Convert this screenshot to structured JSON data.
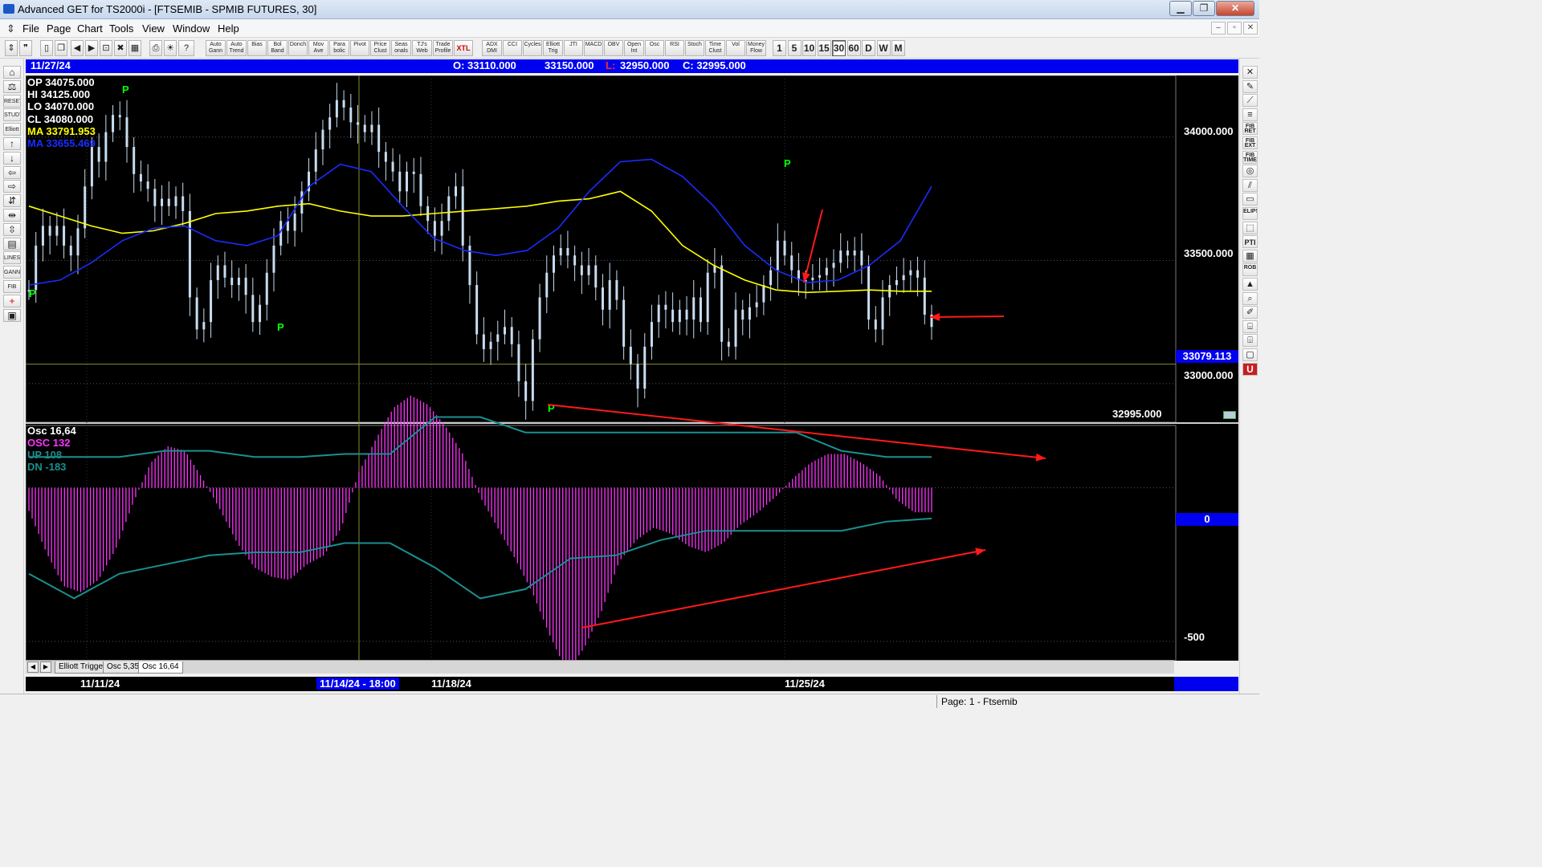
{
  "window": {
    "title": "Advanced GET for TS2000i - [FTSEMIB - SPMIB FUTURES, 30]",
    "min": "▁",
    "max": "❐",
    "close": "✕"
  },
  "menu": [
    "File",
    "Page",
    "Chart",
    "Tools",
    "View",
    "Window",
    "Help"
  ],
  "mdi_controls": [
    "–",
    "▫",
    "✕"
  ],
  "toolbar": {
    "studies": [
      "Auto Gann",
      "Auto Trend",
      "Bias",
      "Bol Band",
      "Donch",
      "Mov Ave",
      "Para bolic",
      "Pivot",
      "Price Clust",
      "Seas onals",
      "TJ's Web",
      "Trade Profile",
      "XTL",
      "ADX DMI",
      "CCI",
      "Cycles",
      "Elliott Trig",
      "JTI",
      "MACD",
      "OBV",
      "Open Int",
      "Osc",
      "RSI",
      "Stoch",
      "Time Clust",
      "Vol",
      "Money Flow"
    ],
    "timeframes": [
      "1",
      "5",
      "10",
      "15",
      "30",
      "60",
      "D",
      "W",
      "M"
    ],
    "selected_timeframe": "30"
  },
  "left_tools": [
    "RESET",
    "STUDY",
    "Elliott",
    "LINES",
    "GANN",
    "FIB"
  ],
  "right_tools": [
    "FIB RET",
    "FIB EXT",
    "FIB TIME",
    "ELIPS",
    "PTI",
    "ROB"
  ],
  "infobar": {
    "date": "11/27/24",
    "open": "O: 33110.000",
    "high": "33150.000",
    "low_prefix": "L:",
    "low": "32950.000",
    "close": "C: 32995.000"
  },
  "price_panel": {
    "stats": {
      "op": "OP  34075.000",
      "hi": "HI   34125.000",
      "lo": "LO  34070.000",
      "cl": "CL  34080.000",
      "ma1": "MA  33791.953",
      "ma2": "MA  33655.469"
    },
    "axis_labels": [
      "34000.000",
      "33500.000",
      "33000.000"
    ],
    "crosshair_value": "33079.113",
    "last_close": "32995.000",
    "pivot_marker": "P"
  },
  "osc_panel": {
    "title": "Osc 16,64",
    "osc": "OSC 132",
    "up": "UP    108",
    "dn": "DN   -183",
    "zero_label": "0",
    "low_label": "-500"
  },
  "tabs": [
    "Elliott Trigger",
    "Osc 5,35",
    "Osc 16,64"
  ],
  "tab_arrows": [
    "◀",
    "▶"
  ],
  "dates": [
    "11/11/24",
    "11/14/24 - 18:00",
    "11/18/24",
    "11/25/24"
  ],
  "status": "Page: 1 - Ftsemib",
  "colors": {
    "candle": "#c8dcf0",
    "ma_yellow": "#ffff00",
    "ma_blue": "#1a2cff",
    "osc_magenta": "#ff33ff",
    "band_teal": "#1a9090",
    "arrow_red": "#ff1a1a",
    "pivot_green": "#00ff00",
    "panel_blue": "#0000f0"
  },
  "chart_data": {
    "type": "candlestick",
    "y_range": [
      32850,
      34250
    ],
    "price_series": [
      33380,
      33560,
      33640,
      33600,
      33640,
      33560,
      33520,
      33630,
      33800,
      33960,
      33900,
      34020,
      34090,
      34080,
      33960,
      33850,
      33820,
      33790,
      33720,
      33750,
      33720,
      33760,
      33700,
      33350,
      33220,
      33250,
      33420,
      33480,
      33430,
      33400,
      33430,
      33360,
      33250,
      33320,
      33450,
      33560,
      33660,
      33620,
      33690,
      33780,
      33860,
      33950,
      34030,
      34080,
      34150,
      34120,
      34060,
      34050,
      34020,
      34050,
      33940,
      33900,
      33860,
      33780,
      33860,
      33850,
      33720,
      33660,
      33600,
      33660,
      33760,
      33800,
      33560,
      33400,
      33200,
      33140,
      33170,
      33200,
      33230,
      33160,
      33010,
      32930,
      33180,
      33350,
      33450,
      33520,
      33550,
      33520,
      33480,
      33440,
      33480,
      33390,
      33300,
      33420,
      33340,
      33150,
      33080,
      32980,
      33150,
      33250,
      33320,
      33300,
      33250,
      33300,
      33260,
      33350,
      33250,
      33450,
      33480,
      33170,
      33150,
      33300,
      33260,
      33310,
      33330,
      33400,
      33460,
      33580,
      33520,
      33460,
      33420,
      33420,
      33430,
      33440,
      33470,
      33490,
      33540,
      33520,
      33540,
      33480,
      33260,
      33220,
      33350,
      33400,
      33420,
      33440,
      33460,
      33430,
      33280,
      33230
    ],
    "ma_yellow": [
      33720,
      33680,
      33640,
      33610,
      33620,
      33650,
      33690,
      33700,
      33720,
      33730,
      33700,
      33680,
      33680,
      33690,
      33700,
      33710,
      33720,
      33740,
      33750,
      33780,
      33700,
      33560,
      33480,
      33420,
      33380,
      33370,
      33375,
      33380,
      33375,
      33375
    ],
    "ma_blue": [
      33400,
      33420,
      33490,
      33580,
      33630,
      33640,
      33580,
      33560,
      33600,
      33800,
      33890,
      33860,
      33720,
      33590,
      33540,
      33520,
      33540,
      33630,
      33780,
      33900,
      33910,
      33840,
      33720,
      33560,
      33460,
      33410,
      33420,
      33480,
      33580,
      33800
    ],
    "osc": {
      "values": [
        -75,
        -210,
        -320,
        -340,
        -300,
        -200,
        -50,
        80,
        135,
        120,
        30,
        -70,
        -180,
        -260,
        -290,
        -300,
        -250,
        -220,
        -130,
        50,
        160,
        260,
        300,
        270,
        200,
        110,
        -30,
        -130,
        -230,
        -340,
        -480,
        -600,
        -520,
        -400,
        -240,
        -170,
        -130,
        -150,
        -190,
        -210,
        -180,
        -120,
        -80,
        -30,
        30,
        80,
        110,
        110,
        80,
        40,
        -40,
        -80,
        -80
      ],
      "up_band": [
        100,
        100,
        100,
        120,
        120,
        100,
        100,
        110,
        110,
        230,
        230,
        180,
        180,
        180,
        180,
        180,
        180,
        180,
        120,
        100,
        100
      ],
      "dn_band": [
        -280,
        -360,
        -280,
        -250,
        -220,
        -210,
        -210,
        -180,
        -180,
        -260,
        -360,
        -330,
        -230,
        -220,
        -170,
        -140,
        -140,
        -140,
        -140,
        -110,
        -100
      ],
      "zero_line": 0,
      "label_low": -500
    }
  }
}
